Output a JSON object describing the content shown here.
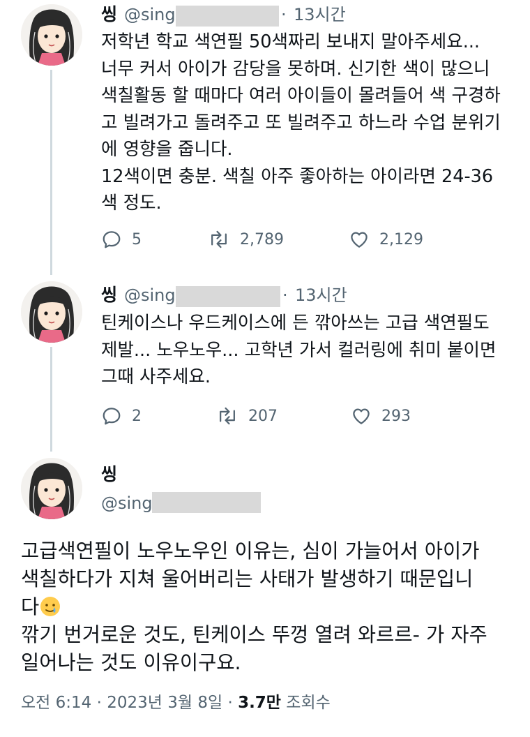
{
  "tweets": [
    {
      "name": "씽",
      "handle": "@sing",
      "time_sep": "·",
      "time": "13시간",
      "text": "저학년 학교 색연필 50색짜리 보내지 말아주세요...\n너무 커서 아이가 감당을 못하며. 신기한 색이 많으니\n색칠활동 할 때마다 여러 아이들이 몰려들어 색 구경하\n고 빌려가고 돌려주고 또 빌려주고 하느라 수업 분위기\n에 영향을 줍니다.\n12색이면 충분. 색칠 아주 좋아하는 아이라면 24-36\n색 정도.",
      "replies": "5",
      "retweets": "2,789",
      "likes": "2,129"
    },
    {
      "name": "씽",
      "handle": "@sing",
      "time_sep": "·",
      "time": "13시간",
      "text": "틴케이스나 우드케이스에 든 깎아쓰는 고급 색연필도\n제발... 노우노우... 고학년 가서 컬러링에 취미 붙이면\n그때 사주세요.",
      "replies": "2",
      "retweets": "207",
      "likes": "293"
    }
  ],
  "main": {
    "name": "씽",
    "handle": "@sing",
    "text_part1": "고급색연필이 노우노우인 이유는, 심이 가늘어서 아이가\n색칠하다가 지쳐 울어버리는 사태가 발생하기 때문입니\n다",
    "text_part2": "\n깎기 번거로운 것도, 틴케이스 뚜껑 열려 와르르- 가 자주\n일어나는 것도 이유이구요.",
    "emoji": "tear-smile-emoji",
    "meta_time": "오전 6:14",
    "meta_sep1": "·",
    "meta_date": "2023년 3월 8일",
    "meta_sep2": "·",
    "meta_views": "3.7만",
    "meta_views_label": "조회수"
  },
  "colors": {
    "text": "#0f1419",
    "secondary": "#536471",
    "thread": "#cfd9de",
    "redaction": "#d9d9d9"
  },
  "icons": [
    "reply-icon",
    "retweet-icon",
    "like-icon"
  ]
}
